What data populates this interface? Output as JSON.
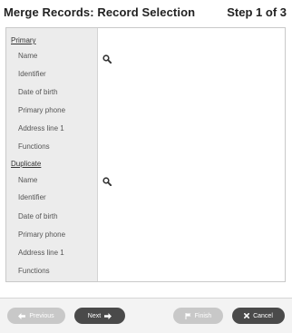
{
  "header": {
    "title": "Merge Records: Record Selection",
    "step": "Step 1 of 3"
  },
  "primary": {
    "heading": "Primary",
    "fields": [
      "Name",
      "Identifier",
      "Date of birth",
      "Primary phone",
      "Address line 1",
      "Functions"
    ]
  },
  "duplicate": {
    "heading": "Duplicate",
    "fields": [
      "Name",
      "Identifier",
      "Date of birth",
      "Primary phone",
      "Address line 1",
      "Functions"
    ]
  },
  "footer": {
    "previous_label": "Previous",
    "next_label": "Next",
    "finish_label": "Finish",
    "cancel_label": "Cancel"
  },
  "icons": {
    "primary_lookup": "search-icon",
    "duplicate_lookup": "search-icon",
    "previous": "arrow-left-icon",
    "next": "arrow-right-icon",
    "finish": "flag-icon",
    "cancel": "close-icon"
  },
  "colors": {
    "label_column_bg": "#ececec",
    "dark_button": "#4a4a4a",
    "disabled_button": "#c8c8c8",
    "footer_bg": "#f3f3f3"
  }
}
